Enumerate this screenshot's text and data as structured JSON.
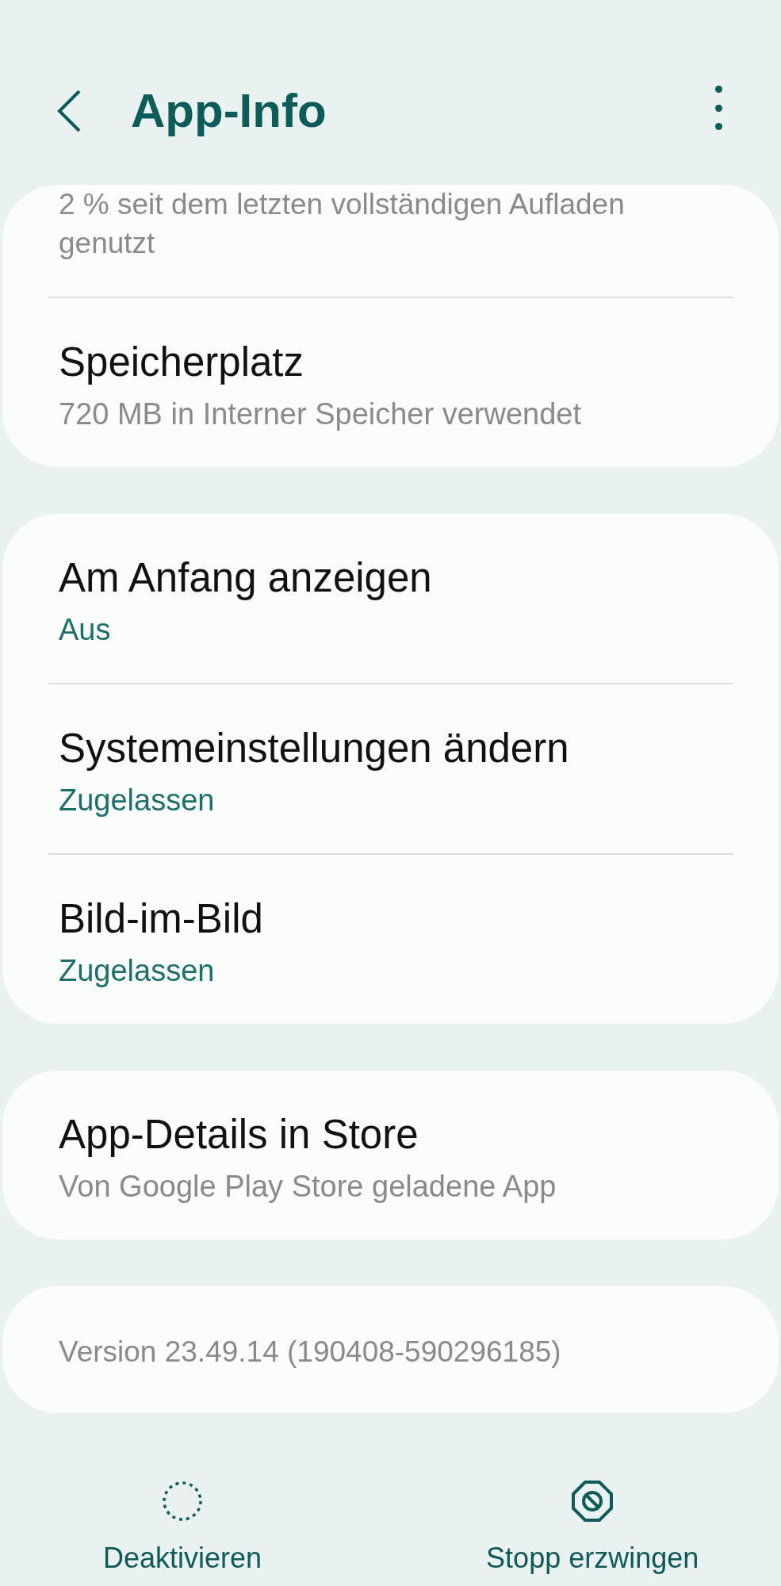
{
  "header": {
    "title": "App-Info"
  },
  "cards": [
    {
      "rows": [
        {
          "kind": "note",
          "text": "2 % seit dem letzten vollständigen Aufladen genutzt"
        },
        {
          "kind": "info",
          "title": "Speicherplatz",
          "subtitle": "720 MB in Interner Speicher verwendet"
        }
      ]
    },
    {
      "rows": [
        {
          "kind": "status",
          "title": "Am Anfang anzeigen",
          "subtitle": "Aus"
        },
        {
          "kind": "status",
          "title": "Systemeinstellungen ändern",
          "subtitle": "Zugelassen"
        },
        {
          "kind": "status",
          "title": "Bild-im-Bild",
          "subtitle": "Zugelassen"
        }
      ]
    },
    {
      "rows": [
        {
          "kind": "info",
          "title": "App-Details in Store",
          "subtitle": "Von Google Play Store geladene App"
        }
      ]
    },
    {
      "rows": [
        {
          "kind": "version",
          "text": "Version 23.49.14 (190408-590296185)"
        }
      ]
    }
  ],
  "actions": [
    {
      "label": "Deaktivieren"
    },
    {
      "label": "Stopp erzwingen"
    }
  ]
}
